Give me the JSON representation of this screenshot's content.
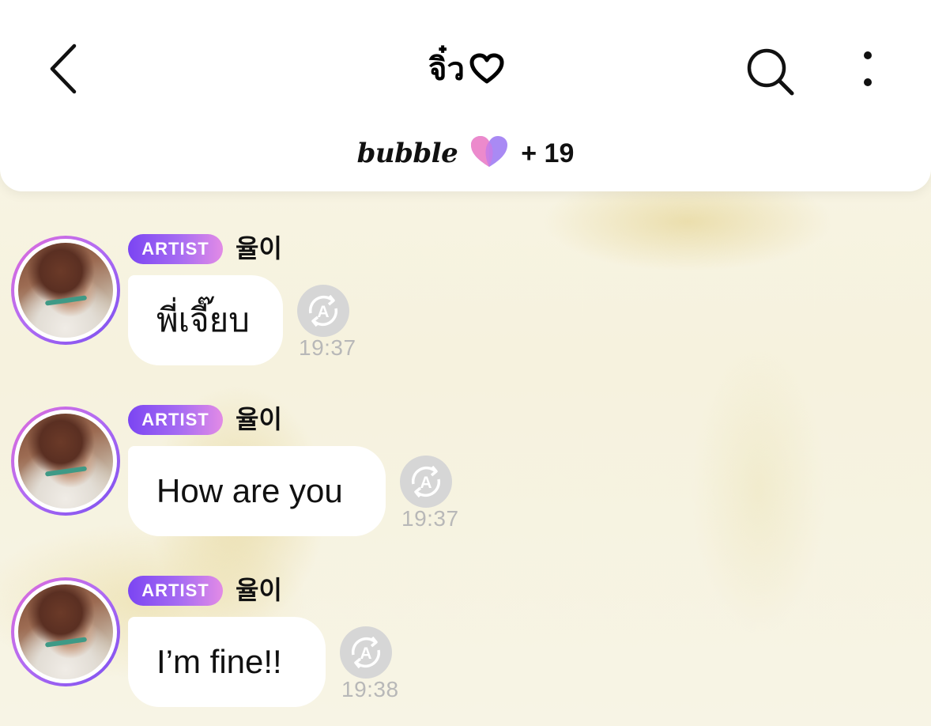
{
  "header": {
    "title": "จิ๋ว",
    "service": "bubble",
    "member_count": "+ 19"
  },
  "icons": {
    "back": "chevron-left-icon",
    "search": "search-icon",
    "more": "more-vertical-icon",
    "title_heart": "heart-outline-icon",
    "bubble_heart": "bubble-heart-icon",
    "translate": "auto-translate-icon"
  },
  "colors": {
    "badge_start": "#7b45f2",
    "badge_end": "#e28be6",
    "timestamp": "#b8b8b8"
  },
  "messages": [
    {
      "badge": "ARTIST",
      "sender": "율이",
      "text": "พี่เจี๊ยบ",
      "time": "19:37"
    },
    {
      "badge": "ARTIST",
      "sender": "율이",
      "text": "How are you",
      "time": "19:37"
    },
    {
      "badge": "ARTIST",
      "sender": "율이",
      "text": "I’m fine!!",
      "time": "19:38"
    }
  ]
}
